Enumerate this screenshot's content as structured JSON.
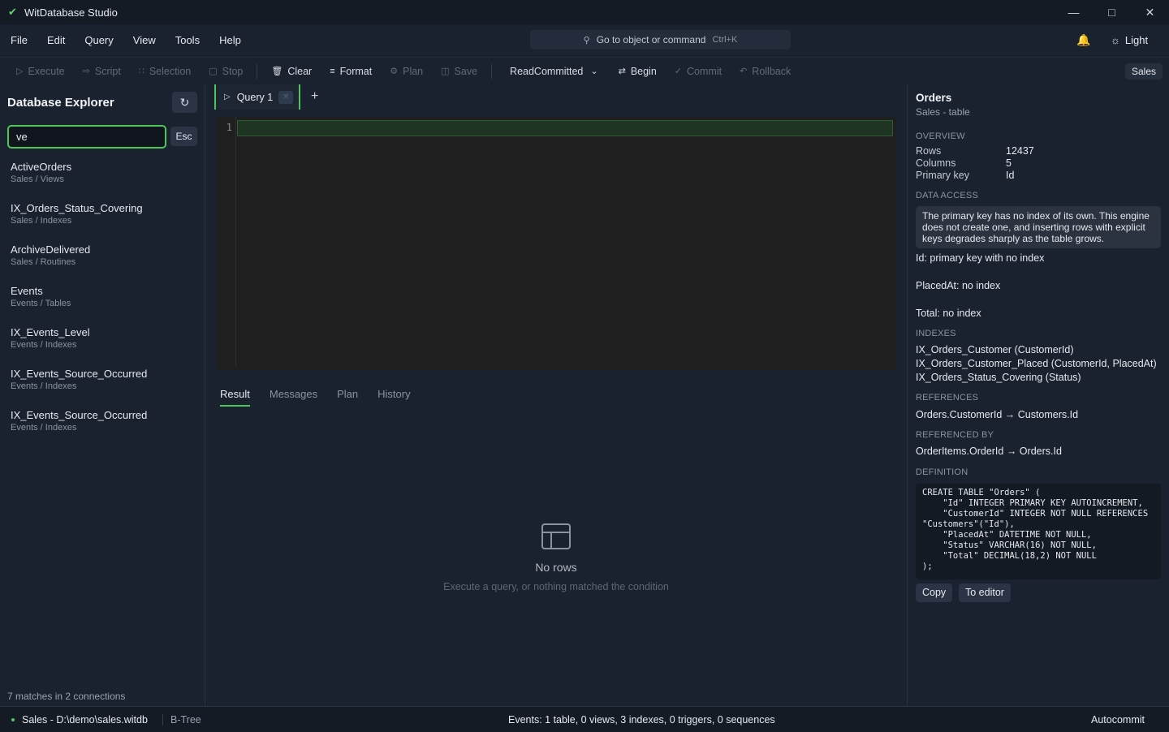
{
  "window": {
    "title": "WitDatabase Studio"
  },
  "menu": [
    "File",
    "Edit",
    "Query",
    "View",
    "Tools",
    "Help"
  ],
  "command_search": {
    "placeholder": "Go to object or command",
    "shortcut": "Ctrl+K"
  },
  "theme": {
    "label": "Light"
  },
  "toolbar": {
    "execute": "Execute",
    "script": "Script",
    "selection": "Selection",
    "stop": "Stop",
    "clear": "Clear",
    "format": "Format",
    "plan": "Plan",
    "save": "Save",
    "isolation": "ReadCommitted",
    "begin": "Begin",
    "commit": "Commit",
    "rollback": "Rollback",
    "connection": "Sales"
  },
  "sidebar": {
    "title": "Database Explorer",
    "search_value": "ve",
    "esc_label": "Esc",
    "items": [
      {
        "name": "ActiveOrders",
        "path": "Sales / Views"
      },
      {
        "name": "IX_Orders_Status_Covering",
        "path": "Sales / Indexes"
      },
      {
        "name": "ArchiveDelivered",
        "path": "Sales / Routines"
      },
      {
        "name": "Events",
        "path": "Events / Tables"
      },
      {
        "name": "IX_Events_Level",
        "path": "Events / Indexes"
      },
      {
        "name": "IX_Events_Source_Occurred",
        "path": "Events / Indexes"
      },
      {
        "name": "IX_Events_Source_Occurred",
        "path": "Events / Indexes"
      }
    ],
    "footer": "7 matches in 2 connections"
  },
  "editor": {
    "tab_label": "Query 1",
    "line_number": "1",
    "result_tabs": [
      "Result",
      "Messages",
      "Plan",
      "History"
    ],
    "empty_title": "No rows",
    "empty_subtitle": "Execute a query, or nothing matched the condition"
  },
  "details": {
    "title": "Orders",
    "subtitle": "Sales - table",
    "overview_label": "OVERVIEW",
    "rows_label": "Rows",
    "rows_value": "12437",
    "columns_label": "Columns",
    "columns_value": "5",
    "pk_label": "Primary key",
    "pk_value": "Id",
    "data_access_label": "DATA ACCESS",
    "note": "The primary key has no index of its own. This engine does not create one, and inserting rows with explicit keys degrades sharply as the table grows.",
    "access_items": [
      "Id: primary key with no index",
      "PlacedAt: no index",
      "Total: no index"
    ],
    "indexes_label": "INDEXES",
    "indexes": [
      "IX_Orders_Customer (CustomerId)",
      "IX_Orders_Customer_Placed (CustomerId, PlacedAt)",
      "IX_Orders_Status_Covering (Status)"
    ],
    "references_label": "REFERENCES",
    "references": [
      "Orders.CustomerId → Customers.Id"
    ],
    "referenced_by_label": "REFERENCED BY",
    "referenced_by": [
      "OrderItems.OrderId → Orders.Id"
    ],
    "definition_label": "DEFINITION",
    "definition": "CREATE TABLE \"Orders\" (\n    \"Id\" INTEGER PRIMARY KEY AUTOINCREMENT,\n    \"CustomerId\" INTEGER NOT NULL REFERENCES\n\"Customers\"(\"Id\"),\n    \"PlacedAt\" DATETIME NOT NULL,\n    \"Status\" VARCHAR(16) NOT NULL,\n    \"Total\" DECIMAL(18,2) NOT NULL\n);",
    "copy_label": "Copy",
    "to_editor_label": "To editor"
  },
  "status": {
    "connection": "Sales - D:\\demo\\sales.witdb",
    "engine": "B-Tree",
    "summary": "Events: 1 table, 0 views, 3 indexes, 0 triggers, 0 sequences",
    "mode": "Autocommit"
  },
  "colors": {
    "accent": "#4fc65b",
    "background": "#1a2230",
    "editor_bg": "#1f1f1f"
  }
}
